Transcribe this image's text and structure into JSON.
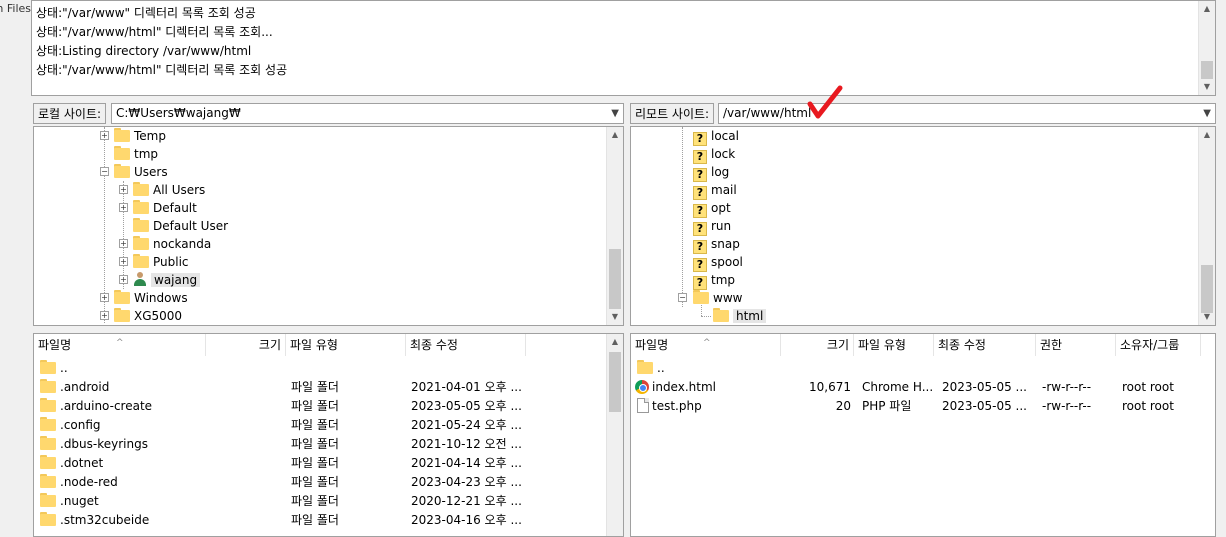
{
  "window": {
    "left_edge_text": "n Files",
    "accent_checkmark_color": "#e8191f"
  },
  "log": {
    "lines": [
      "상태:\"/var/www\" 디렉터리 목록 조회 성공",
      "상태:\"/var/www/html\" 디렉터리 목록 조회...",
      "상태:Listing directory /var/www/html",
      "상태:\"/var/www/html\" 디렉터리 목록 조회 성공"
    ]
  },
  "local": {
    "site_label": "로컬 사이트:",
    "site_path": "C:₩Users₩wajang₩",
    "tree": [
      {
        "label": "Temp",
        "expander": "+",
        "icon": "folder"
      },
      {
        "label": "tmp",
        "expander": "",
        "icon": "folder"
      },
      {
        "label": "Users",
        "expander": "-",
        "icon": "folder"
      },
      {
        "label": "All Users",
        "expander": "+",
        "icon": "folder"
      },
      {
        "label": "Default",
        "expander": "+",
        "icon": "folder"
      },
      {
        "label": "Default User",
        "expander": "",
        "icon": "folder"
      },
      {
        "label": "nockanda",
        "expander": "+",
        "icon": "folder"
      },
      {
        "label": "Public",
        "expander": "+",
        "icon": "folder"
      },
      {
        "label": "wajang",
        "expander": "+",
        "icon": "user-icon"
      },
      {
        "label": "Windows",
        "expander": "+",
        "icon": "folder"
      },
      {
        "label": "XG5000",
        "expander": "+",
        "icon": "folder"
      }
    ],
    "columns": {
      "name": "파일명",
      "size": "크기",
      "type": "파일 유형",
      "modified": "최종 수정"
    },
    "files": [
      {
        "name": "..",
        "size": "",
        "type": "",
        "modified": ""
      },
      {
        "name": ".android",
        "size": "",
        "type": "파일 폴더",
        "modified": "2021-04-01 오후 ..."
      },
      {
        "name": ".arduino-create",
        "size": "",
        "type": "파일 폴더",
        "modified": "2023-05-05 오후 ..."
      },
      {
        "name": ".config",
        "size": "",
        "type": "파일 폴더",
        "modified": "2021-05-24 오후 ..."
      },
      {
        "name": ".dbus-keyrings",
        "size": "",
        "type": "파일 폴더",
        "modified": "2021-10-12 오전 ..."
      },
      {
        "name": ".dotnet",
        "size": "",
        "type": "파일 폴더",
        "modified": "2021-04-14 오후 ..."
      },
      {
        "name": ".node-red",
        "size": "",
        "type": "파일 폴더",
        "modified": "2023-04-23 오후 ..."
      },
      {
        "name": ".nuget",
        "size": "",
        "type": "파일 폴더",
        "modified": "2020-12-21 오후 ..."
      },
      {
        "name": ".stm32cubeide",
        "size": "",
        "type": "파일 폴더",
        "modified": "2023-04-16 오후 ..."
      }
    ]
  },
  "remote": {
    "site_label": "리모트 사이트:",
    "site_path": "/var/www/html",
    "tree": [
      {
        "label": "local",
        "icon": "question-folder"
      },
      {
        "label": "lock",
        "icon": "question-folder"
      },
      {
        "label": "log",
        "icon": "question-folder"
      },
      {
        "label": "mail",
        "icon": "question-folder"
      },
      {
        "label": "opt",
        "icon": "question-folder"
      },
      {
        "label": "run",
        "icon": "question-folder"
      },
      {
        "label": "snap",
        "icon": "question-folder"
      },
      {
        "label": "spool",
        "icon": "question-folder"
      },
      {
        "label": "tmp",
        "icon": "question-folder"
      },
      {
        "label": "www",
        "icon": "folder",
        "expander": "-"
      },
      {
        "label": "html",
        "icon": "folder",
        "selected": true
      }
    ],
    "columns": {
      "name": "파일명",
      "size": "크기",
      "type": "파일 유형",
      "modified": "최종 수정",
      "perms": "권한",
      "owner": "소유자/그룹"
    },
    "files": [
      {
        "name": "..",
        "icon": "folder",
        "size": "",
        "type": "",
        "modified": "",
        "perms": "",
        "owner": ""
      },
      {
        "name": "index.html",
        "icon": "chrome-icon",
        "size": "10,671",
        "type": "Chrome H...",
        "modified": "2023-05-05 ...",
        "perms": "-rw-r--r--",
        "owner": "root root"
      },
      {
        "name": "test.php",
        "icon": "file-icon",
        "size": "20",
        "type": "PHP 파일",
        "modified": "2023-05-05 ...",
        "perms": "-rw-r--r--",
        "owner": "root root"
      }
    ]
  }
}
